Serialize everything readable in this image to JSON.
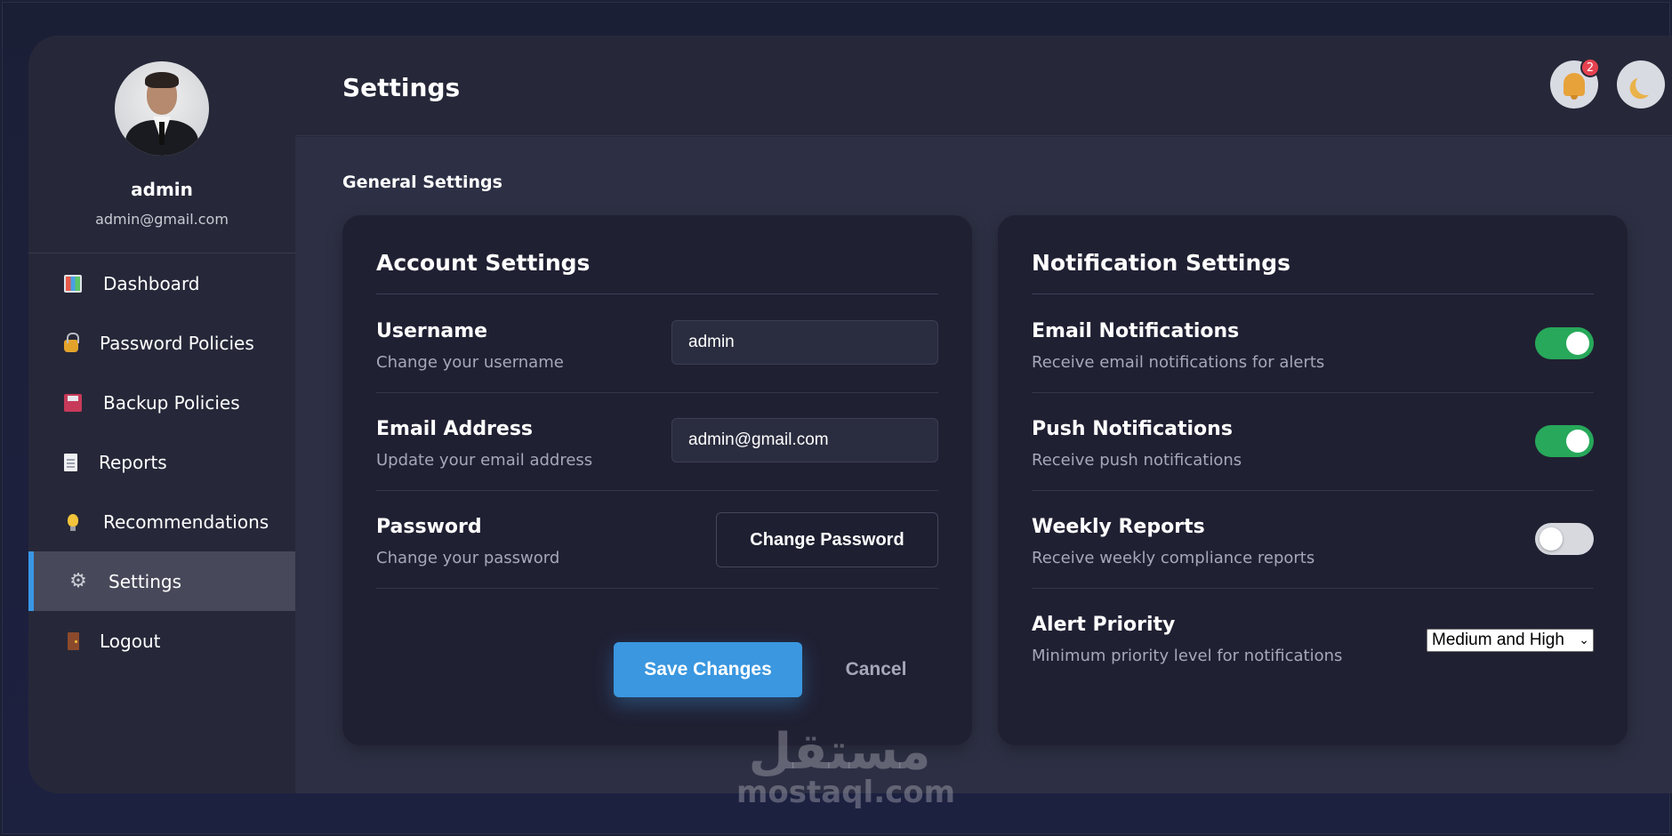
{
  "profile": {
    "name": "admin",
    "email": "admin@gmail.com"
  },
  "sidebar": {
    "items": [
      {
        "label": "Dashboard",
        "icon": "chart-icon"
      },
      {
        "label": "Password Policies",
        "icon": "lock-icon"
      },
      {
        "label": "Backup Policies",
        "icon": "floppy-disk-icon"
      },
      {
        "label": "Reports",
        "icon": "document-icon"
      },
      {
        "label": "Recommendations",
        "icon": "light-bulb-icon"
      },
      {
        "label": "Settings",
        "icon": "gear-icon",
        "active": true
      },
      {
        "label": "Logout",
        "icon": "door-icon"
      }
    ]
  },
  "header": {
    "title": "Settings",
    "notification_count": "2"
  },
  "main": {
    "section_title": "General Settings",
    "account": {
      "title": "Account Settings",
      "username_label": "Username",
      "username_desc": "Change your username",
      "username_value": "admin",
      "email_label": "Email Address",
      "email_desc": "Update your email address",
      "email_value": "admin@gmail.com",
      "password_label": "Password",
      "password_desc": "Change your password",
      "change_password_label": "Change Password",
      "save_label": "Save Changes",
      "cancel_label": "Cancel"
    },
    "notifications": {
      "title": "Notification Settings",
      "email_label": "Email Notifications",
      "email_desc": "Receive email notifications for alerts",
      "email_on": true,
      "push_label": "Push Notifications",
      "push_desc": "Receive push notifications",
      "push_on": true,
      "weekly_label": "Weekly Reports",
      "weekly_desc": "Receive weekly compliance reports",
      "weekly_on": false,
      "priority_label": "Alert Priority",
      "priority_desc": "Minimum priority level for notifications",
      "priority_value": "Medium and High"
    }
  },
  "watermark": {
    "arabic": "مستقل",
    "latin": "mostaql.com"
  },
  "colors": {
    "accent": "#3a97e0",
    "toggle_on": "#27a85a",
    "badge": "#e6414f"
  }
}
